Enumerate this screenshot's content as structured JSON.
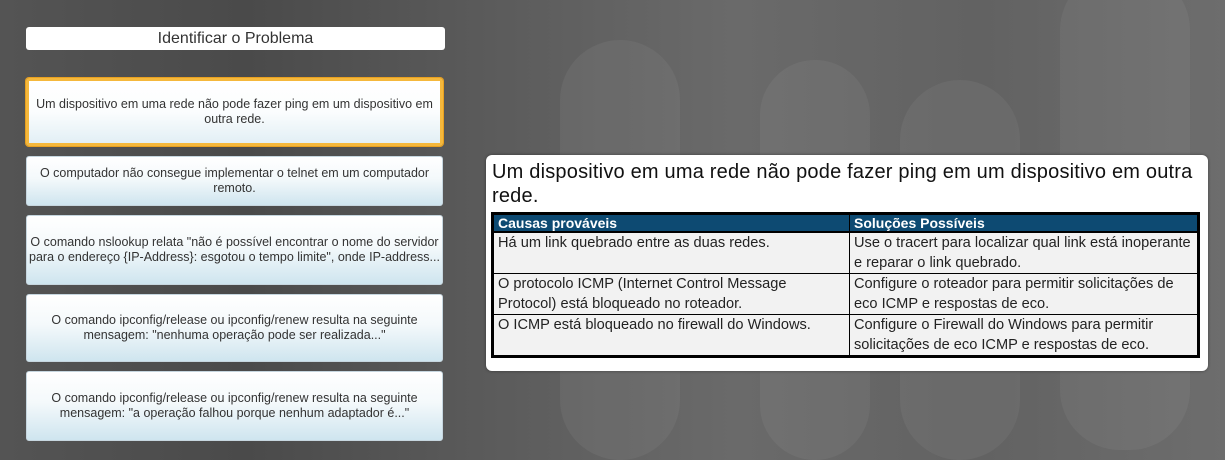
{
  "header": {
    "title": "Identificar o Problema"
  },
  "options": [
    {
      "label": "Um dispositivo em uma rede não pode fazer ping em um dispositivo em outra rede.",
      "selected": true
    },
    {
      "label": "O computador não consegue implementar o telnet em um computador remoto.",
      "selected": false
    },
    {
      "label": "O comando nslookup relata \"não é possível encontrar o nome do servidor para o endereço {IP-Address}: esgotou o tempo limite\", onde IP-address...",
      "selected": false
    },
    {
      "label": "O comando ipconfig/release ou ipconfig/renew resulta na seguinte mensagem: \"nenhuma operação pode ser realizada...\"",
      "selected": false
    },
    {
      "label": "O comando ipconfig/release ou ipconfig/renew resulta na seguinte mensagem: \"a operação falhou porque nenhum adaptador é...\"",
      "selected": false
    }
  ],
  "detail": {
    "title": "Um dispositivo em uma rede não pode fazer ping em um dispositivo em outra rede.",
    "columns": [
      "Causas prováveis",
      "Soluções Possíveis"
    ],
    "rows": [
      [
        "Há um link quebrado entre as duas redes.",
        "Use o tracert para localizar qual link está inoperante e reparar o link quebrado."
      ],
      [
        "O protocolo ICMP (Internet Control Message Protocol) está bloqueado no roteador.",
        "Configure o roteador para permitir solicitações de eco ICMP e respostas de eco."
      ],
      [
        "O ICMP está bloqueado no firewall do Windows.",
        "Configure o Firewall do Windows para permitir solicitações de eco ICMP e respostas de eco."
      ]
    ]
  },
  "colors": {
    "table_header_bg": "#0d4a72",
    "selected_border": "#f5b83c",
    "option_gradient_bottom": "#cfe5ef"
  }
}
